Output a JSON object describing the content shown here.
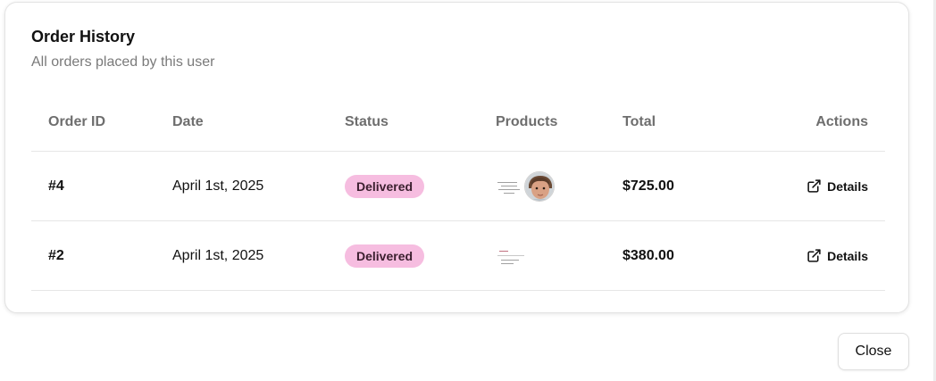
{
  "card": {
    "title": "Order History",
    "subtitle": "All orders placed by this user"
  },
  "table": {
    "columns": {
      "order_id": "Order ID",
      "date": "Date",
      "status": "Status",
      "products": "Products",
      "total": "Total",
      "actions": "Actions"
    },
    "rows": [
      {
        "id": "#4",
        "date": "April 1st, 2025",
        "status": "Delivered",
        "products": [
          "product-thumbnail",
          "child-avatar"
        ],
        "total": "$725.00",
        "action_label": "Details"
      },
      {
        "id": "#2",
        "date": "April 1st, 2025",
        "status": "Delivered",
        "products": [
          "product-thumbnail"
        ],
        "total": "$380.00",
        "action_label": "Details"
      }
    ]
  },
  "footer": {
    "close_label": "Close"
  },
  "colors": {
    "badge_bg": "#f6bde0",
    "border": "#e6e6e6",
    "muted_text": "#7a7a7a"
  },
  "icons": {
    "details": "external-link-icon"
  }
}
